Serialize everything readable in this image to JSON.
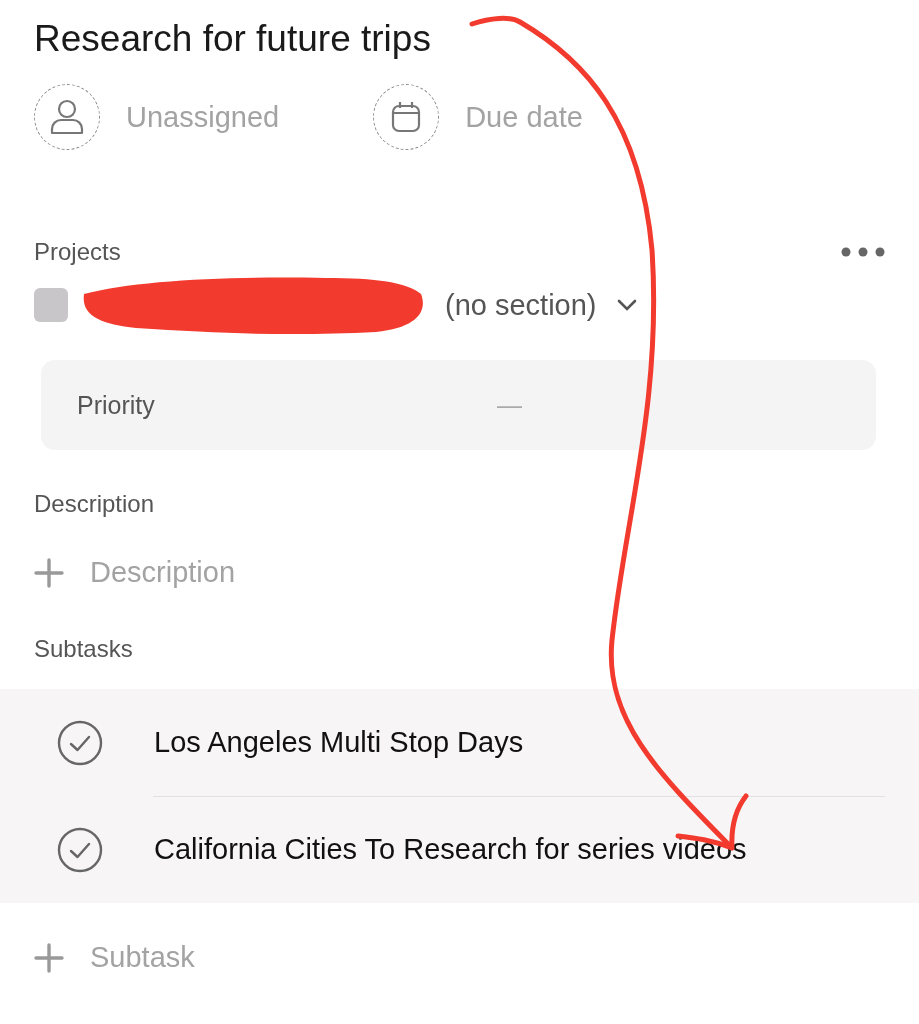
{
  "title": "Research for future trips",
  "assignee": {
    "label": "Unassigned"
  },
  "due_date": {
    "label": "Due date"
  },
  "projects": {
    "label": "Projects",
    "section": "(no section)"
  },
  "priority": {
    "label": "Priority",
    "value": "—"
  },
  "description": {
    "label": "Description",
    "placeholder": "Description"
  },
  "subtasks": {
    "label": "Subtasks",
    "items": [
      {
        "title": "Los Angeles Multi Stop Days"
      },
      {
        "title": "California Cities To Research for series videos"
      }
    ]
  },
  "add_subtask": {
    "placeholder": "Subtask"
  }
}
